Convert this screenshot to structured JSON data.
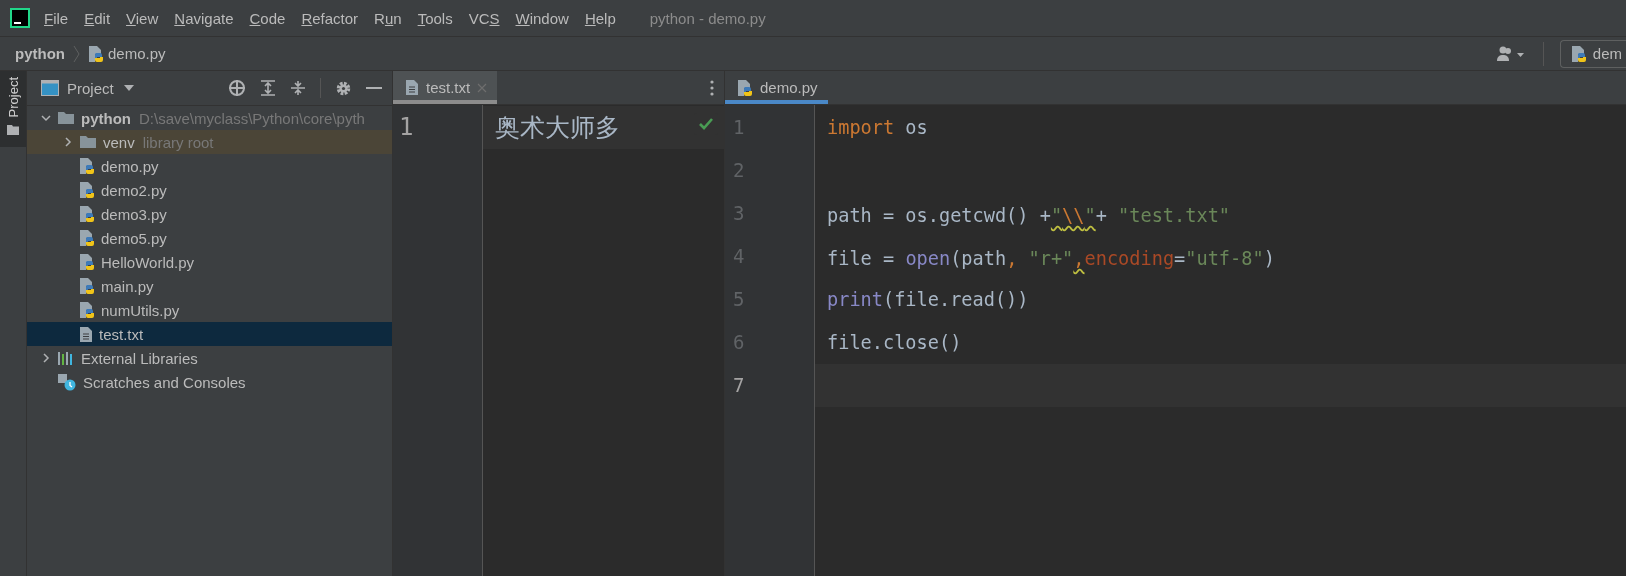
{
  "menu_bar": {
    "items": [
      {
        "key": "F",
        "post": "ile"
      },
      {
        "key": "E",
        "post": "dit"
      },
      {
        "key": "V",
        "post": "iew"
      },
      {
        "key": "N",
        "post": "avigate"
      },
      {
        "key": "C",
        "post": "ode"
      },
      {
        "key": "R",
        "post": "efactor"
      },
      {
        "pre": "R",
        "key": "u",
        "post": "n"
      },
      {
        "key": "T",
        "post": "ools"
      },
      {
        "pre": "VC",
        "key": "S"
      },
      {
        "key": "W",
        "post": "indow"
      },
      {
        "key": "H",
        "post": "elp"
      }
    ],
    "title": "python - demo.py"
  },
  "navigation_bar": {
    "breadcrumbs": [
      {
        "label": "python",
        "kind": "folder"
      },
      {
        "label": "demo.py",
        "kind": "python-file"
      }
    ],
    "run_config": "dem"
  },
  "tool_window": {
    "stripe_tab": "Project",
    "title": "Project"
  },
  "tree": [
    {
      "label": "python",
      "kind": "folder",
      "bold": true,
      "hint": "D:\\save\\myclass\\Python\\core\\pyth",
      "expanded": true,
      "selected": false,
      "children": [
        {
          "label": "venv",
          "kind": "library-folder",
          "hint": "library root",
          "expanded": false,
          "selected": false
        },
        {
          "label": "demo.py",
          "kind": "python-file",
          "selected": false
        },
        {
          "label": "demo2.py",
          "kind": "python-file",
          "selected": false
        },
        {
          "label": "demo3.py",
          "kind": "python-file",
          "selected": false
        },
        {
          "label": "demo5.py",
          "kind": "python-file",
          "selected": false
        },
        {
          "label": "HelloWorld.py",
          "kind": "python-file",
          "selected": false
        },
        {
          "label": "main.py",
          "kind": "python-file",
          "selected": false
        },
        {
          "label": "numUtils.py",
          "kind": "python-file",
          "selected": false
        },
        {
          "label": "test.txt",
          "kind": "text-file",
          "selected": true
        }
      ]
    },
    {
      "label": "External Libraries",
      "kind": "libraries",
      "expanded": false,
      "selected": false
    },
    {
      "label": "Scratches and Consoles",
      "kind": "scratches",
      "selected": false
    }
  ],
  "editors": [
    {
      "tab": {
        "label": "test.txt",
        "kind": "text-file",
        "selected": true,
        "focused": false
      },
      "inspection_ok": true,
      "lines": [
        {
          "number": "1",
          "current": true,
          "tokens": [
            {
              "text": "奥术大师多",
              "kind": "text"
            }
          ]
        }
      ]
    },
    {
      "tab": {
        "label": "demo.py",
        "kind": "python-file",
        "selected": true,
        "focused": true
      },
      "lines": [
        {
          "number": "1",
          "current": false,
          "tokens": [
            {
              "text": "import",
              "kind": "keyword"
            },
            {
              "text": " os",
              "kind": "plain"
            }
          ]
        },
        {
          "number": "2",
          "current": false
        },
        {
          "number": "3",
          "current": false,
          "tokens": [
            {
              "text": "path = os.getcwd() +",
              "kind": "plain"
            },
            {
              "text": "\"",
              "kind": "string",
              "warning": true
            },
            {
              "text": "\\\\",
              "kind": "escape",
              "warning": true
            },
            {
              "text": "\"",
              "kind": "string",
              "warning": true
            },
            {
              "text": "+ ",
              "kind": "plain"
            },
            {
              "text": "\"test.txt\"",
              "kind": "string"
            }
          ]
        },
        {
          "number": "4",
          "current": false,
          "tokens": [
            {
              "text": "file = ",
              "kind": "plain"
            },
            {
              "text": "open",
              "kind": "builtin"
            },
            {
              "text": "(path",
              "kind": "plain"
            },
            {
              "text": ", ",
              "kind": "comma"
            },
            {
              "text": "\"r+\"",
              "kind": "string"
            },
            {
              "text": ",",
              "kind": "comma",
              "warning": true
            },
            {
              "text": "encoding",
              "kind": "param"
            },
            {
              "text": "=",
              "kind": "plain"
            },
            {
              "text": "\"utf-8\"",
              "kind": "string"
            },
            {
              "text": ")",
              "kind": "plain"
            }
          ]
        },
        {
          "number": "5",
          "current": false,
          "tokens": [
            {
              "text": "print",
              "kind": "builtin"
            },
            {
              "text": "(file.read())",
              "kind": "plain"
            }
          ]
        },
        {
          "number": "6",
          "current": false,
          "tokens": [
            {
              "text": "file.close()",
              "kind": "plain"
            }
          ]
        },
        {
          "number": "7",
          "current": true
        }
      ]
    }
  ]
}
